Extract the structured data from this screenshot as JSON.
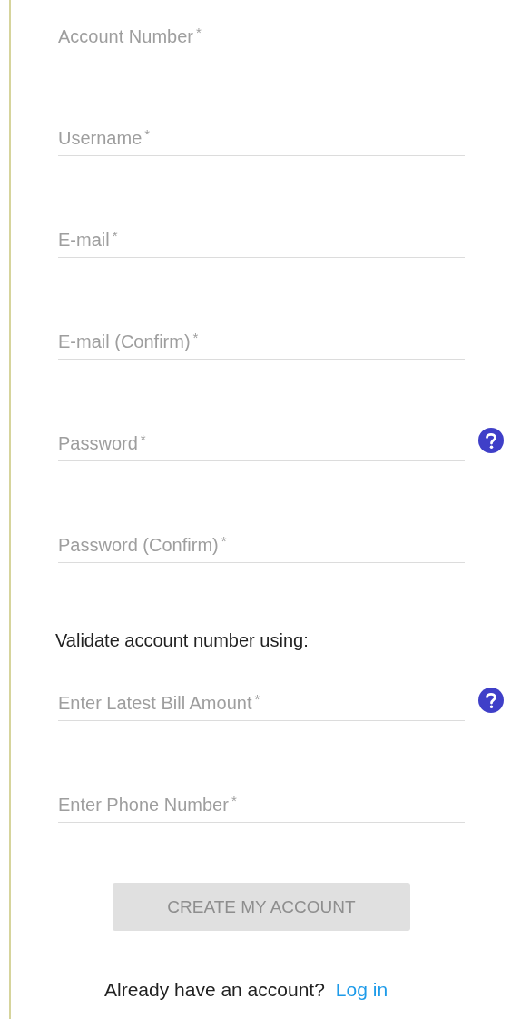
{
  "fields": [
    {
      "label": "Account Number",
      "marker": "*",
      "help": false
    },
    {
      "label": "Username",
      "marker": "*",
      "help": false
    },
    {
      "label": "E-mail",
      "marker": "*",
      "help": false
    },
    {
      "label": "E-mail (Confirm)",
      "marker": "*",
      "help": false
    },
    {
      "label": "Password",
      "marker": "*",
      "help": true
    },
    {
      "label": "Password (Confirm)",
      "marker": "*",
      "help": false
    }
  ],
  "validation": {
    "heading": "Validate account number using:",
    "fields": [
      {
        "label": "Enter Latest Bill Amount",
        "marker": "*",
        "help": true
      },
      {
        "label": "Enter Phone Number",
        "marker": "*",
        "help": false
      }
    ]
  },
  "button": {
    "label": "CREATE MY ACCOUNT",
    "disabled": true
  },
  "footer": {
    "prompt": "Already have an account?",
    "link": "Log in"
  }
}
